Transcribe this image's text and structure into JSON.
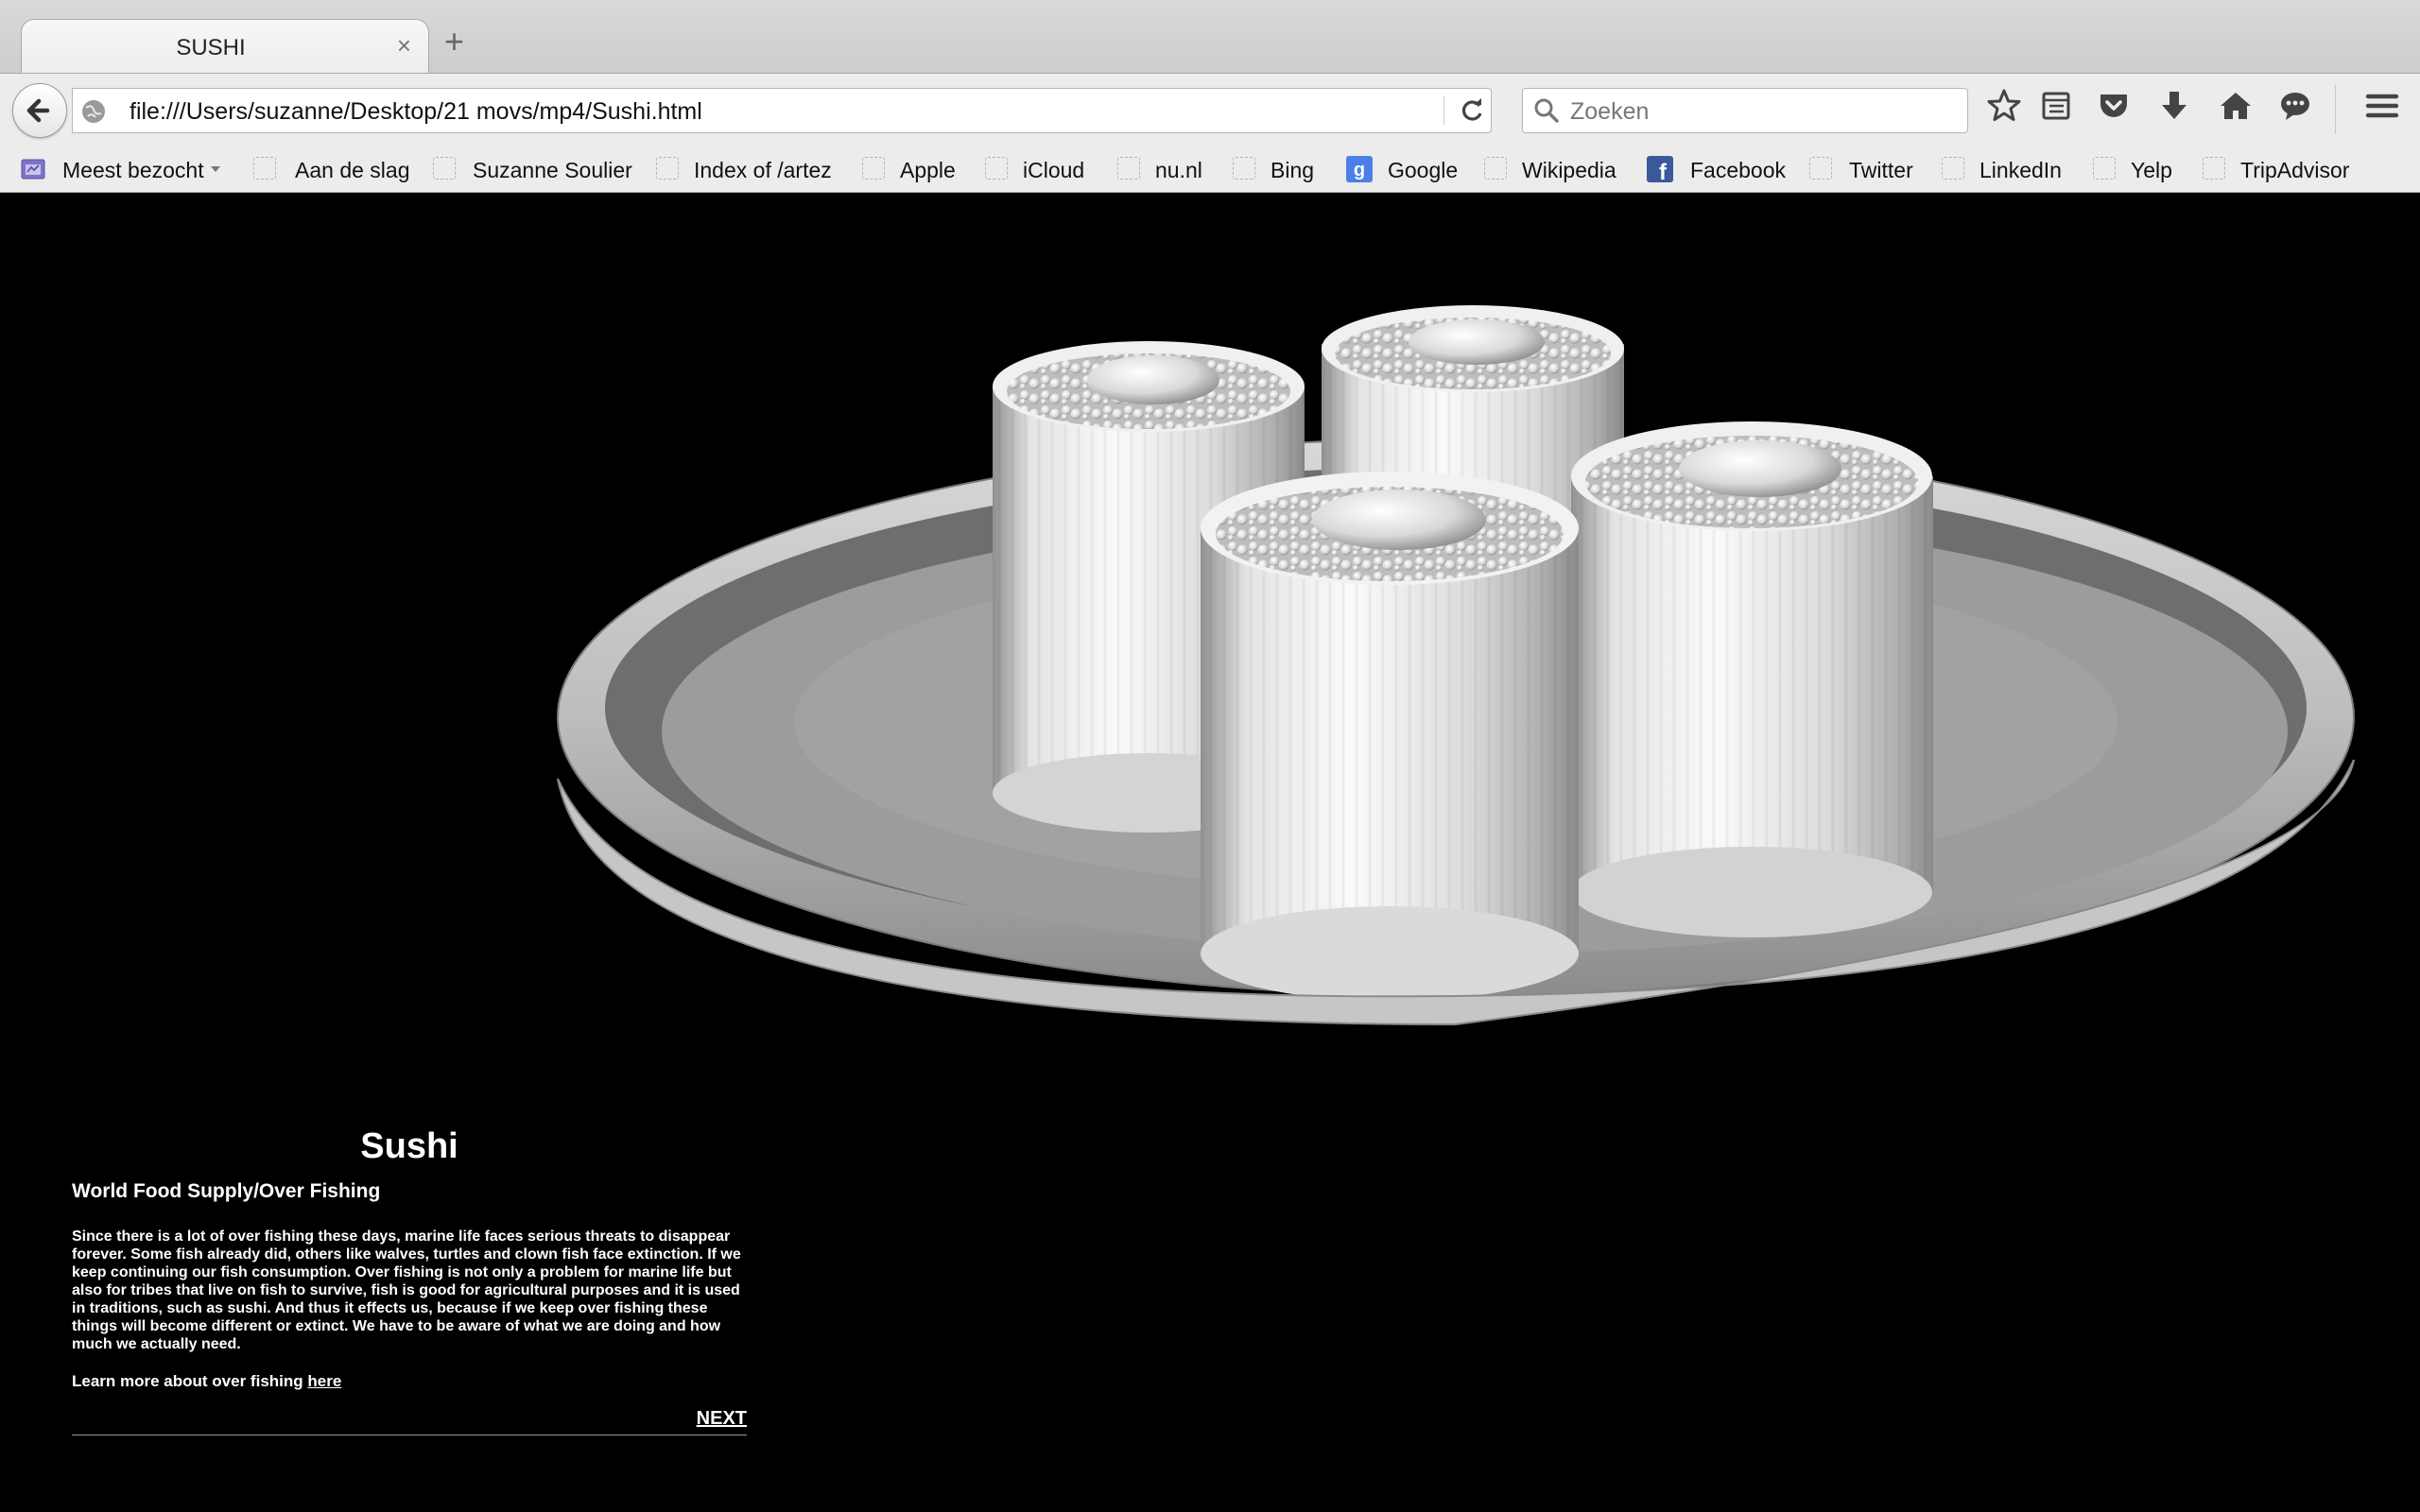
{
  "browser": {
    "tab_title": "SUSHI",
    "close_glyph": "×",
    "new_tab_glyph": "+",
    "url": "file:///Users/suzanne/Desktop/21 movs/mp4/Sushi.html",
    "search_placeholder": "Zoeken",
    "toolbar_icons": [
      "back-icon",
      "site-identity-icon",
      "reload-icon",
      "search-icon",
      "bookmark-star-icon",
      "reading-list-icon",
      "pocket-icon",
      "downloads-icon",
      "home-icon",
      "chat-icon",
      "hamburger-menu-icon"
    ]
  },
  "bookmarks": [
    {
      "label": "Meest bezocht",
      "icon": "most-visited-folder-icon"
    },
    {
      "label": "Aan de slag",
      "icon": "placeholder-favicon"
    },
    {
      "label": "Suzanne Soulier",
      "icon": "placeholder-favicon"
    },
    {
      "label": "Index of /artez",
      "icon": "placeholder-favicon"
    },
    {
      "label": "Apple",
      "icon": "placeholder-favicon"
    },
    {
      "label": "iCloud",
      "icon": "placeholder-favicon"
    },
    {
      "label": "nu.nl",
      "icon": "placeholder-favicon"
    },
    {
      "label": "Bing",
      "icon": "placeholder-favicon"
    },
    {
      "label": "Google",
      "icon": "google-icon"
    },
    {
      "label": "Wikipedia",
      "icon": "placeholder-favicon"
    },
    {
      "label": "Facebook",
      "icon": "facebook-icon"
    },
    {
      "label": "Twitter",
      "icon": "placeholder-favicon"
    },
    {
      "label": "LinkedIn",
      "icon": "placeholder-favicon"
    },
    {
      "label": "Yelp",
      "icon": "placeholder-favicon"
    },
    {
      "label": "TripAdvisor",
      "icon": "placeholder-favicon"
    }
  ],
  "page": {
    "title": "Sushi",
    "subtitle": "World Food Supply/Over Fishing",
    "body": "Since there is a lot of over fishing these days, marine life faces serious threats to disappear forever. Some fish already did, others like walves, turtles and clown fish face extinction. If we keep continuing our fish consumption. Over fishing is not only a problem for marine life but also for tribes that live on fish to survive, fish is good for agricultural purposes and it is used in traditions, such as sushi. And thus it effects us, because if we keep over fishing these things will become different or extinct. We have to be aware of what we are doing and how much we actually need.",
    "learn_more_prefix": "Learn more about over fishing ",
    "learn_more_link": "here",
    "next_label": "NEXT"
  },
  "colors": {
    "page_background": "#000000",
    "chrome_background": "#ececec",
    "render_gray": "#9c9c9c"
  }
}
